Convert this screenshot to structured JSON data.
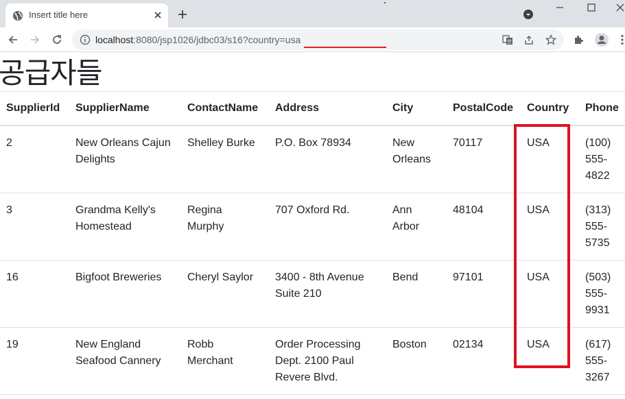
{
  "browser": {
    "tab_title": "Insert title here",
    "url_host": "localhost",
    "url_rest": ":8080/jsp1026/jdbc03/s16?country=usa",
    "accent_red": "#e0121f"
  },
  "page": {
    "title": "공급자들",
    "headers": [
      "SupplierId",
      "SupplierName",
      "ContactName",
      "Address",
      "City",
      "PostalCode",
      "Country",
      "Phone"
    ],
    "rows": [
      {
        "id": "2",
        "name": [
          "New Orleans Cajun",
          "Delights"
        ],
        "contact": [
          "Shelley Burke"
        ],
        "address": [
          "P.O. Box 78934"
        ],
        "city": [
          "New",
          "Orleans"
        ],
        "postal": "70117",
        "country": "USA",
        "phone": [
          "(100)",
          "555-",
          "4822"
        ]
      },
      {
        "id": "3",
        "name": [
          "Grandma Kelly's",
          "Homestead"
        ],
        "contact": [
          "Regina",
          "Murphy"
        ],
        "address": [
          "707 Oxford Rd."
        ],
        "city": [
          "Ann",
          "Arbor"
        ],
        "postal": "48104",
        "country": "USA",
        "phone": [
          "(313)",
          "555-",
          "5735"
        ]
      },
      {
        "id": "16",
        "name": [
          "Bigfoot Breweries"
        ],
        "contact": [
          "Cheryl Saylor"
        ],
        "address": [
          "3400 - 8th Avenue",
          "Suite 210"
        ],
        "city": [
          "Bend"
        ],
        "postal": "97101",
        "country": "USA",
        "phone": [
          "(503)",
          "555-",
          "9931"
        ]
      },
      {
        "id": "19",
        "name": [
          "New England",
          "Seafood Cannery"
        ],
        "contact": [
          "Robb",
          "Merchant"
        ],
        "address": [
          "Order Processing",
          "Dept. 2100 Paul",
          "Revere Blvd."
        ],
        "city": [
          "Boston"
        ],
        "postal": "02134",
        "country": "USA",
        "phone": [
          "(617)",
          "555-",
          "3267"
        ]
      }
    ]
  }
}
